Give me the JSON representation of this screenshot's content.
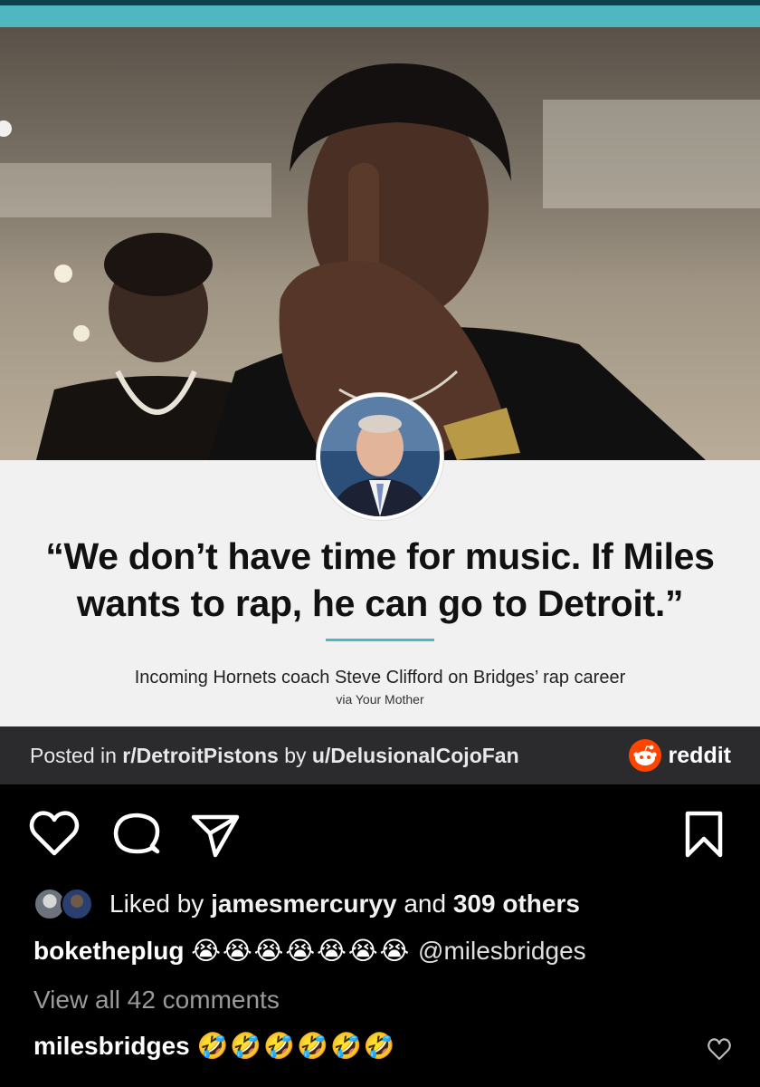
{
  "post_image": {
    "quote": "“We don’t have time for music. If Miles wants to rap, he can go to Detroit.”",
    "caption": "Incoming Hornets coach Steve Clifford on Bridges’ rap career",
    "via": "via Your Mother",
    "reddit_bar": {
      "prefix": "Posted in ",
      "subreddit": "r/DetroitPistons",
      "by": " by ",
      "user": "u/DelusionalCojoFan",
      "brand": "reddit"
    }
  },
  "actions": {
    "like_icon": "heart-icon",
    "comment_icon": "comment-bubble-icon",
    "share_icon": "paper-plane-icon",
    "save_icon": "bookmark-icon"
  },
  "likes": {
    "prefix": "Liked by ",
    "user": "jamesmercuryy",
    "middle": " and ",
    "count": "309 others"
  },
  "caption_comment": {
    "user": "boketheplug",
    "emojis": "😭😭😭😭😭😭😭",
    "mention": "@milesbridges"
  },
  "view_all": "View all 42 comments",
  "reply": {
    "user": "milesbridges",
    "emojis": "🤣🤣🤣🤣🤣🤣"
  },
  "colors": {
    "accent_teal": "#4fb7c2",
    "reddit_orange": "#ff4500",
    "reddit_bar_bg": "#2b2b2d"
  }
}
